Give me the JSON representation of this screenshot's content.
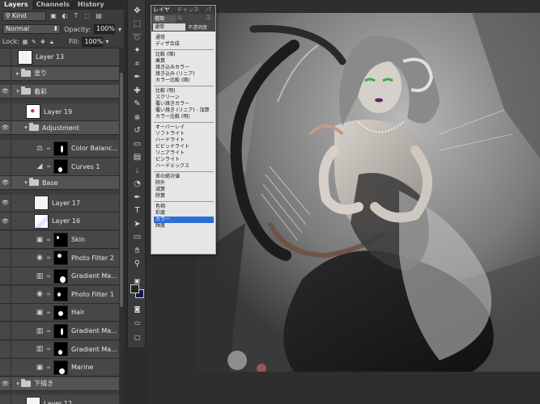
{
  "layers_panel": {
    "tabs": [
      {
        "label": "Layers",
        "active": true
      },
      {
        "label": "Channels",
        "active": false
      },
      {
        "label": "History",
        "active": false
      }
    ],
    "filter_kind": "Kind",
    "blend_mode": "Normal",
    "opacity_label": "Opacity:",
    "opacity_value": "100%",
    "lock_label": "Lock:",
    "fill_label": "Fill:",
    "fill_value": "100%",
    "layers": [
      {
        "name": "Layer 13",
        "kind": "pixel",
        "visible": false,
        "depth": 0
      },
      {
        "name": "塗り",
        "kind": "group",
        "visible": false,
        "expanded": false,
        "depth": 0
      },
      {
        "name": "着彩",
        "kind": "group",
        "visible": true,
        "expanded": true,
        "depth": 0
      },
      {
        "name": "Layer 19",
        "kind": "pixel",
        "visible": false,
        "depth": 1
      },
      {
        "name": "Adjustment",
        "kind": "group",
        "visible": true,
        "expanded": true,
        "depth": 1
      },
      {
        "name": "Color Balanc...",
        "kind": "adjustment",
        "icon": "color-balance",
        "visible": false,
        "depth": 2
      },
      {
        "name": "Curves 1",
        "kind": "adjustment",
        "icon": "curves",
        "visible": false,
        "depth": 2
      },
      {
        "name": "Base",
        "kind": "group",
        "visible": true,
        "expanded": true,
        "depth": 1
      },
      {
        "name": "Layer 17",
        "kind": "pixel",
        "visible": true,
        "depth": 2
      },
      {
        "name": "Layer 16",
        "kind": "pixel",
        "visible": true,
        "depth": 2
      },
      {
        "name": "Skin",
        "kind": "adjustment",
        "icon": "solid-color",
        "visible": false,
        "depth": 2
      },
      {
        "name": "Photo Filter 2",
        "kind": "adjustment",
        "icon": "photo-filter",
        "visible": false,
        "depth": 2
      },
      {
        "name": "Gradient Ma...",
        "kind": "adjustment",
        "icon": "gradient-map",
        "visible": false,
        "depth": 2
      },
      {
        "name": "Photo Filter 1",
        "kind": "adjustment",
        "icon": "photo-filter",
        "visible": false,
        "depth": 2
      },
      {
        "name": "Hair",
        "kind": "adjustment",
        "icon": "solid-color",
        "visible": false,
        "depth": 2
      },
      {
        "name": "Gradient Ma...",
        "kind": "adjustment",
        "icon": "gradient-map",
        "visible": false,
        "depth": 2
      },
      {
        "name": "Gradient Ma...",
        "kind": "adjustment",
        "icon": "gradient-map",
        "visible": false,
        "depth": 2
      },
      {
        "name": "Marine",
        "kind": "adjustment",
        "icon": "solid-color",
        "visible": false,
        "depth": 2
      },
      {
        "name": "下描き",
        "kind": "group",
        "visible": true,
        "expanded": true,
        "depth": 0
      },
      {
        "name": "Layer 12",
        "kind": "pixel",
        "visible": false,
        "depth": 1
      }
    ]
  },
  "blend_popup": {
    "tabs": [
      {
        "label": "レイヤー",
        "active": true
      },
      {
        "label": "チャンネル",
        "active": false
      },
      {
        "label": "パス",
        "active": false
      }
    ],
    "kind": "種類",
    "mode": "通常",
    "opacity_label": "不透明度",
    "groups": [
      [
        "通常",
        "ディザ合成"
      ],
      [
        "比較 (暗)",
        "乗算",
        "焼き込みカラー",
        "焼き込み (リニア)",
        "カラー比較 (暗)"
      ],
      [
        "比較 (明)",
        "スクリーン",
        "覆い焼きカラー",
        "覆い焼き (リニア) - 加算",
        "カラー比較 (明)"
      ],
      [
        "オーバーレイ",
        "ソフトライト",
        "ハードライト",
        "ビビッドライト",
        "リニアライト",
        "ピンライト",
        "ハードミックス"
      ],
      [
        "差の絶対値",
        "除外",
        "減算",
        "除算"
      ],
      [
        "色相",
        "彩度",
        "カラー",
        "輝度"
      ]
    ],
    "selected": "カラー"
  },
  "colors": {
    "foreground": "#1b2a1b",
    "background": "#161a4a",
    "selection": "#2d6fd8"
  }
}
